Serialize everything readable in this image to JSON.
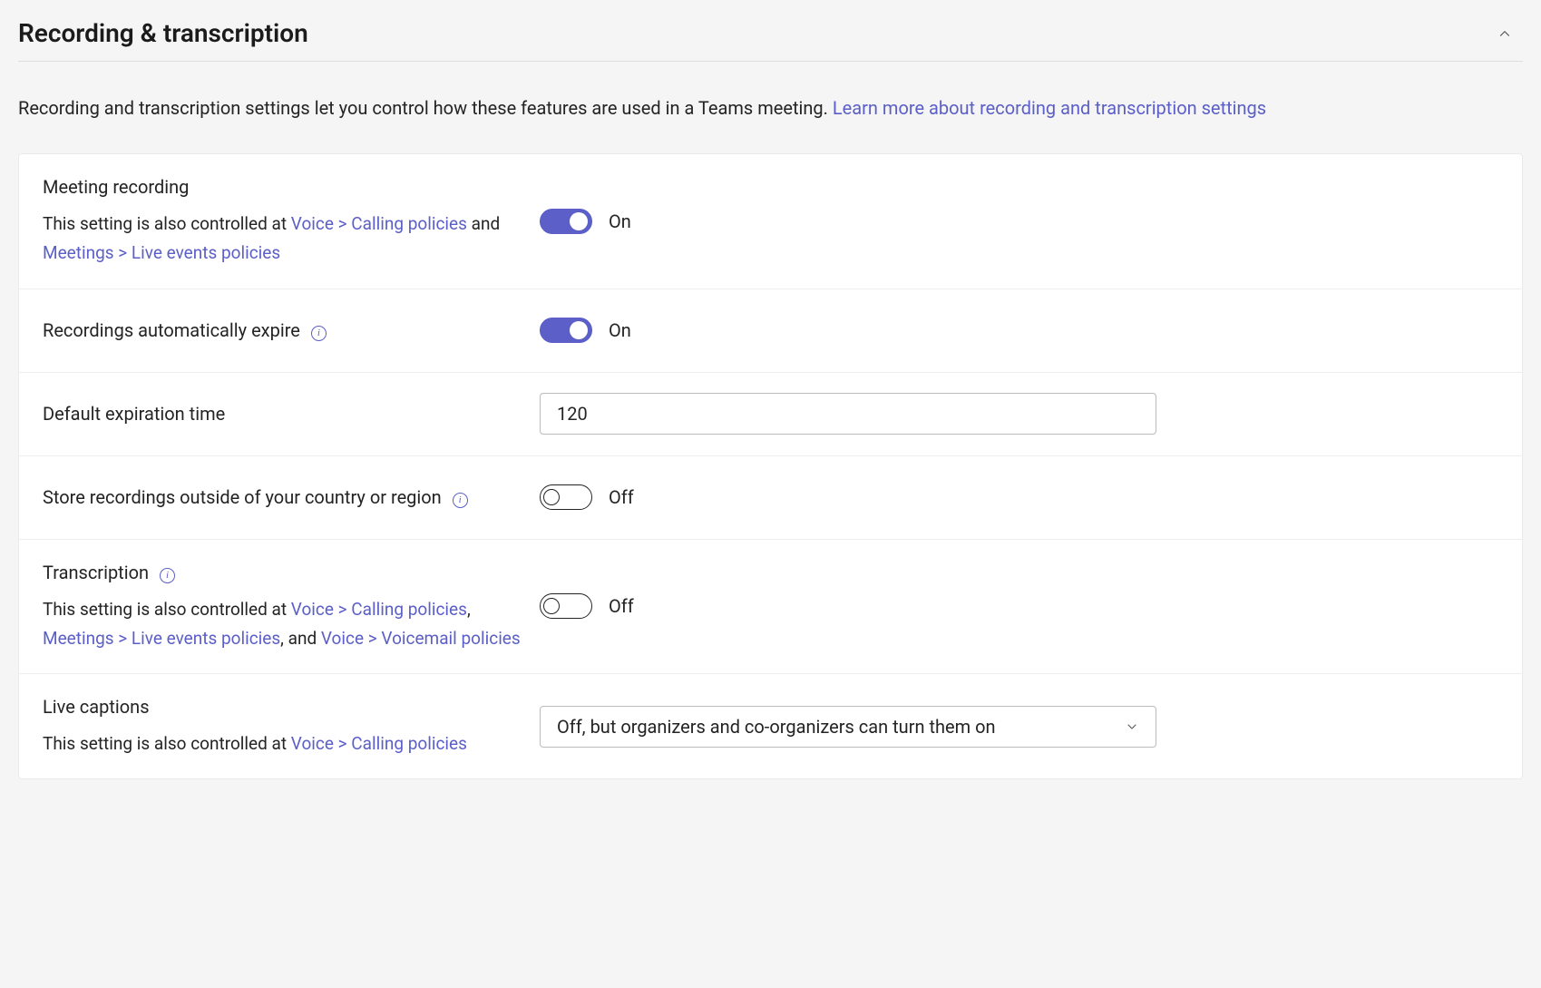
{
  "section": {
    "title": "Recording & transcription",
    "description": "Recording and transcription settings let you control how these features are used in a Teams meeting. ",
    "learn_more": "Learn more about recording and transcription settings"
  },
  "settings": {
    "meeting_recording": {
      "label": "Meeting recording",
      "sub_prefix": "This setting is also controlled at ",
      "link1": "Voice > Calling policies",
      "mid1": " and ",
      "link2": "Meetings > Live events policies",
      "state": "On",
      "on": true
    },
    "auto_expire": {
      "label": "Recordings automatically expire",
      "state": "On",
      "on": true
    },
    "expiration_time": {
      "label": "Default expiration time",
      "value": "120"
    },
    "store_outside": {
      "label": "Store recordings outside of your country or region",
      "state": "Off",
      "on": false
    },
    "transcription": {
      "label": "Transcription",
      "sub_prefix": "This setting is also controlled at ",
      "link1": "Voice > Calling policies",
      "sep1": ", ",
      "link2": "Meetings > Live events policies",
      "sep2": ", and ",
      "link3": "Voice > Voicemail policies",
      "state": "Off",
      "on": false
    },
    "live_captions": {
      "label": "Live captions",
      "sub_prefix": "This setting is also controlled at ",
      "link1": "Voice > Calling policies",
      "value": "Off, but organizers and co-organizers can turn them on"
    }
  }
}
